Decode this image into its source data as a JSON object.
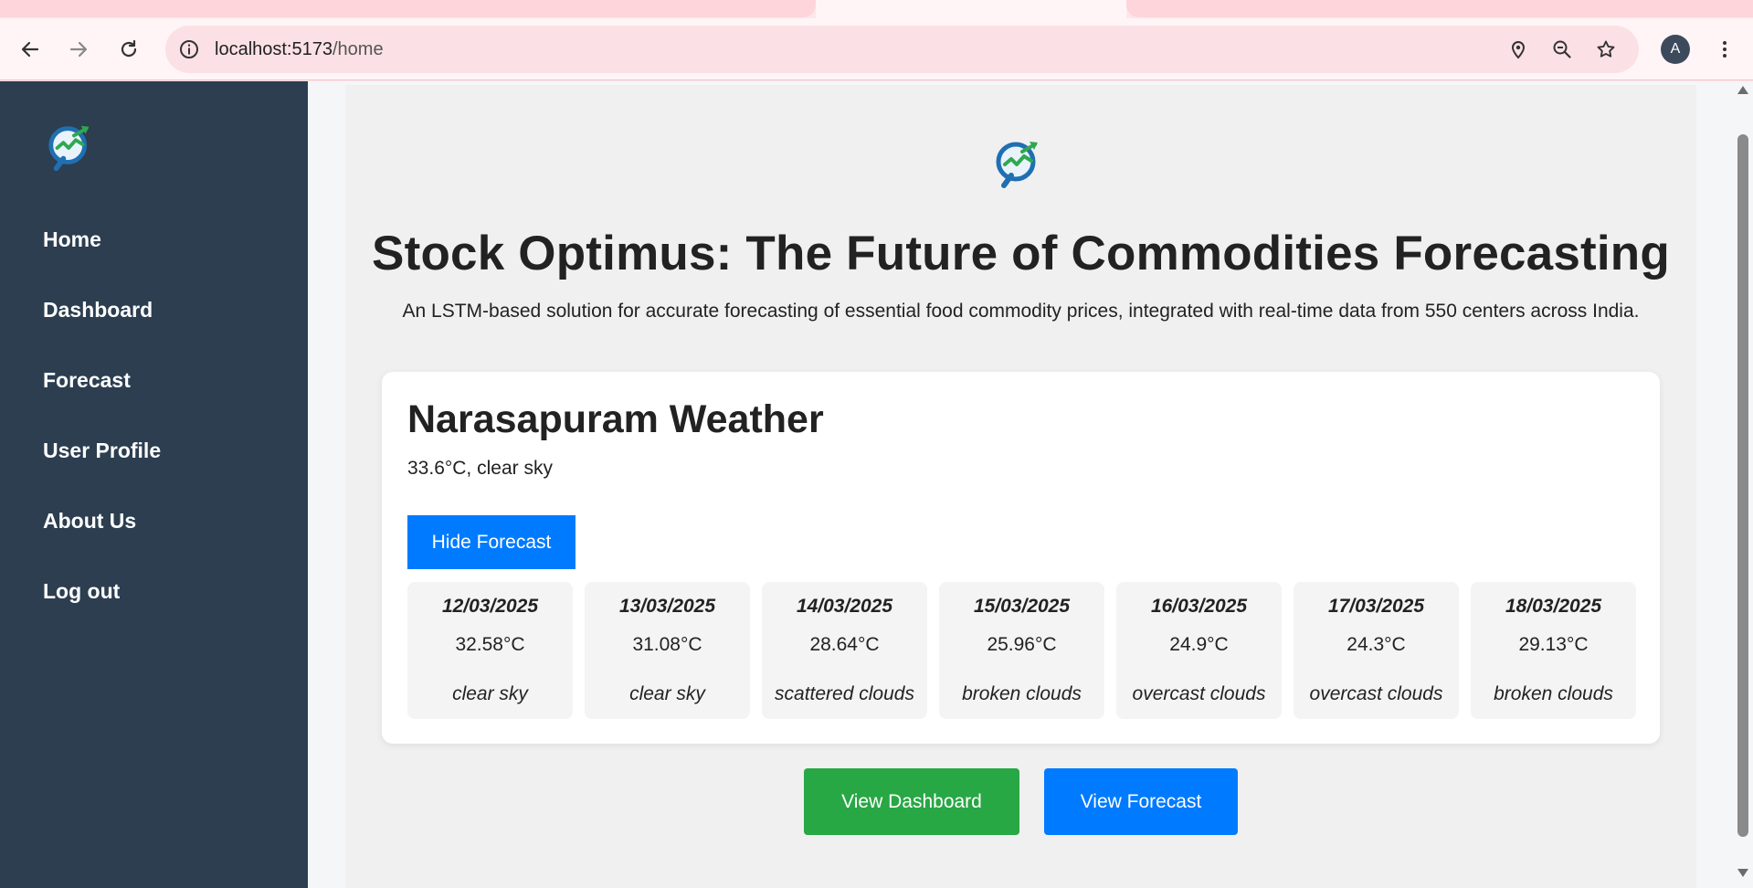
{
  "browser": {
    "url_host": "localhost:5173",
    "url_path": "/home",
    "profile_initial": "A",
    "icons": [
      "back-arrow-icon",
      "forward-arrow-icon",
      "reload-icon",
      "site-info-icon",
      "location-pin-icon",
      "zoom-out-icon",
      "bookmark-star-icon",
      "menu-kebab-icon"
    ]
  },
  "sidebar": {
    "items": [
      {
        "label": "Home"
      },
      {
        "label": "Dashboard"
      },
      {
        "label": "Forecast"
      },
      {
        "label": "User Profile"
      },
      {
        "label": "About Us"
      },
      {
        "label": "Log out"
      }
    ]
  },
  "hero": {
    "title": "Stock Optimus: The Future of Commodities Forecasting",
    "subtitle": "An LSTM-based solution for accurate forecasting of essential food commodity prices, integrated with real-time data from 550 centers across India."
  },
  "weather": {
    "title": "Narasapuram Weather",
    "current": "33.6°C, clear sky",
    "toggle_label": "Hide Forecast",
    "days": [
      {
        "date": "12/03/2025",
        "temp": "32.58°C",
        "desc": "clear sky"
      },
      {
        "date": "13/03/2025",
        "temp": "31.08°C",
        "desc": "clear sky"
      },
      {
        "date": "14/03/2025",
        "temp": "28.64°C",
        "desc": "scattered clouds"
      },
      {
        "date": "15/03/2025",
        "temp": "25.96°C",
        "desc": "broken clouds"
      },
      {
        "date": "16/03/2025",
        "temp": "24.9°C",
        "desc": "overcast clouds"
      },
      {
        "date": "17/03/2025",
        "temp": "24.3°C",
        "desc": "overcast clouds"
      },
      {
        "date": "18/03/2025",
        "temp": "29.13°C",
        "desc": "broken clouds"
      }
    ]
  },
  "actions": {
    "dashboard_label": "View Dashboard",
    "forecast_label": "View Forecast"
  },
  "colors": {
    "sidebar": "#2c3e50",
    "primary": "#007bff",
    "success": "#28a745"
  }
}
